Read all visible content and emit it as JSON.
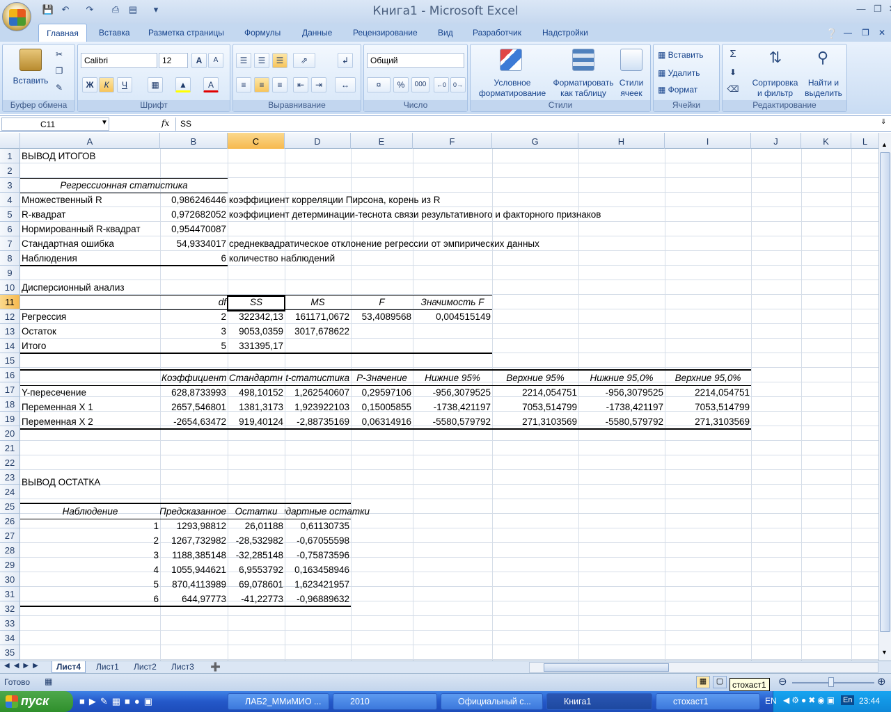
{
  "window": {
    "title": "Книга1 - Microsoft Excel"
  },
  "tabs": [
    "Главная",
    "Вставка",
    "Разметка страницы",
    "Формулы",
    "Данные",
    "Рецензирование",
    "Вид",
    "Разработчик",
    "Надстройки"
  ],
  "ribbon": {
    "clipboard": {
      "paste": "Вставить",
      "label": "Буфер обмена"
    },
    "font": {
      "name": "Calibri",
      "size": "12",
      "label": "Шрифт",
      "bold": "Ж",
      "italic": "К",
      "underline": "Ч",
      "grow": "A",
      "shrink": "A",
      "color_letter": "A"
    },
    "alignment": {
      "label": "Выравнивание"
    },
    "number": {
      "format": "Общий",
      "label": "Число",
      "percent": "%",
      "thousands": "000"
    },
    "styles": {
      "cond": "Условное",
      "cond2": "форматирование",
      "table": "Форматировать",
      "table2": "как таблицу",
      "cell": "Стили",
      "cell2": "ячеек",
      "label": "Стили"
    },
    "cells": {
      "insert": "Вставить",
      "delete": "Удалить",
      "format": "Формат",
      "label": "Ячейки"
    },
    "editing": {
      "sum": "Σ",
      "sort": "Сортировка",
      "sort2": "и фильтр",
      "find": "Найти и",
      "find2": "выделить",
      "label": "Редактирование"
    }
  },
  "formula_bar": {
    "name_box": "C11",
    "fx": "fx",
    "content": "SS"
  },
  "columns": [
    "A",
    "B",
    "C",
    "D",
    "E",
    "F",
    "G",
    "H",
    "I",
    "J",
    "K",
    "L"
  ],
  "rows": [
    "1",
    "2",
    "3",
    "4",
    "5",
    "6",
    "7",
    "8",
    "9",
    "10",
    "11",
    "12",
    "13",
    "14",
    "15",
    "16",
    "17",
    "18",
    "19",
    "20",
    "21",
    "22",
    "23",
    "24",
    "25",
    "26",
    "27",
    "28",
    "29",
    "30",
    "31",
    "32",
    "33",
    "34",
    "35"
  ],
  "sheet": {
    "r1": "ВЫВОД ИТОГОВ",
    "r3": "Регрессионная статистика",
    "r4": [
      "Множественный R",
      "0,986246446",
      "коэффициент корреляции Пирсона, корень из R"
    ],
    "r5": [
      "R-квадрат",
      "0,972682052",
      "коэффициент детерминации-теснота связи результативного и факторного признаков"
    ],
    "r6": [
      "Нормированный R-квадрат",
      "0,954470087"
    ],
    "r7": [
      "Стандартная ошибка",
      "54,9334017",
      "среднеквадратическое отклонение регрессии от эмпирических данных"
    ],
    "r8": [
      "Наблюдения",
      "6",
      "количество наблюдений"
    ],
    "r10": "Дисперсионный анализ",
    "r11": [
      "df",
      "SS",
      "MS",
      "F",
      "Значимость F"
    ],
    "r12": [
      "Регрессия",
      "2",
      "322342,13",
      "161171,0672",
      "53,4089568",
      "0,004515149"
    ],
    "r13": [
      "Остаток",
      "3",
      "9053,0359",
      "3017,678622"
    ],
    "r14": [
      "Итого",
      "5",
      "331395,17"
    ],
    "r16": [
      "Коэффициент",
      "Стандартн",
      "t-статистика",
      "P-Значение",
      "Нижние 95%",
      "Верхние 95%",
      "Нижние 95,0%",
      "Верхние 95,0%"
    ],
    "r17": [
      "Y-пересечение",
      "628,8733993",
      "498,10152",
      "1,262540607",
      "0,29597106",
      "-956,3079525",
      "2214,054751",
      "-956,3079525",
      "2214,054751"
    ],
    "r18": [
      "Переменная X 1",
      "2657,546801",
      "1381,3173",
      "1,923922103",
      "0,15005855",
      "-1738,421197",
      "7053,514799",
      "-1738,421197",
      "7053,514799"
    ],
    "r19": [
      "Переменная X 2",
      "-2654,63472",
      "919,40124",
      "-2,88735169",
      "0,06314916",
      "-5580,579792",
      "271,3103569",
      "-5580,579792",
      "271,3103569"
    ],
    "r23": "ВЫВОД ОСТАТКА",
    "r25": [
      "Наблюдение",
      "Предсказанное",
      "Остатки",
      "Стандартные остатки"
    ],
    "residuals": [
      [
        "1",
        "1293,98812",
        "26,01188",
        "0,61130735"
      ],
      [
        "2",
        "1267,732982",
        "-28,532982",
        "-0,67055598"
      ],
      [
        "3",
        "1188,385148",
        "-32,285148",
        "-0,75873596"
      ],
      [
        "4",
        "1055,944621",
        "6,9553792",
        "0,163458946"
      ],
      [
        "5",
        "870,4113989",
        "69,078601",
        "1,623421957"
      ],
      [
        "6",
        "644,97773",
        "-41,22773",
        "-0,96889632"
      ]
    ]
  },
  "sheet_tabs": [
    "Лист4",
    "Лист1",
    "Лист2",
    "Лист3"
  ],
  "status": {
    "ready": "Готово",
    "zoom_tooltip": "стохаст1"
  },
  "taskbar": {
    "start": "пуск",
    "items": [
      "ЛАБ2_ММиМИО ...",
      "2010",
      "Официальный с...",
      "Книга1",
      "стохаст1"
    ],
    "lang": "EN",
    "lang2": "En",
    "time": "23:44"
  }
}
